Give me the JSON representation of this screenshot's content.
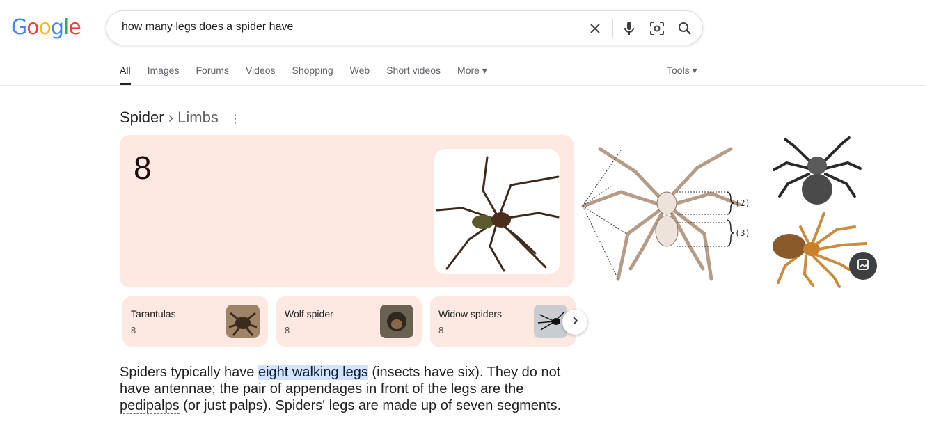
{
  "logo": {
    "letters": [
      "G",
      "o",
      "o",
      "g",
      "l",
      "e"
    ],
    "colors": [
      "#4285f4",
      "#ea4335",
      "#fbbc05",
      "#4285f4",
      "#34a853",
      "#ea4335"
    ]
  },
  "search": {
    "query": "how many legs does a spider have"
  },
  "icons": {
    "clear": "close-icon",
    "mic": "mic-icon",
    "lens": "camera-lens-icon",
    "search": "search-icon"
  },
  "tabs": [
    {
      "label": "All",
      "active": true
    },
    {
      "label": "Images"
    },
    {
      "label": "Forums"
    },
    {
      "label": "Videos"
    },
    {
      "label": "Shopping"
    },
    {
      "label": "Web"
    },
    {
      "label": "Short videos"
    },
    {
      "label": "More ▾"
    }
  ],
  "tools_label": "Tools ▾",
  "breadcrumb": {
    "root": "Spider",
    "separator": "›",
    "child": "Limbs"
  },
  "answer": {
    "value": "8"
  },
  "related": [
    {
      "name": "Tarantulas",
      "value": "8"
    },
    {
      "name": "Wolf spider",
      "value": "8"
    },
    {
      "name": "Widow spiders",
      "value": "8"
    }
  ],
  "diagram_labels": {
    "a": "(2)",
    "b": "(3)"
  },
  "description": {
    "before": "Spiders typically have ",
    "highlight": "eight walking legs",
    "middle": " (insects have six). They do not have antennae; the pair of appendages in front of the legs are the ",
    "term": "pedipalps",
    "after": " (or just palps). Spiders' legs are made up of seven segments."
  },
  "colors": {
    "answer_bg": "#fde8e2",
    "highlight_bg": "#d3e3fd"
  }
}
